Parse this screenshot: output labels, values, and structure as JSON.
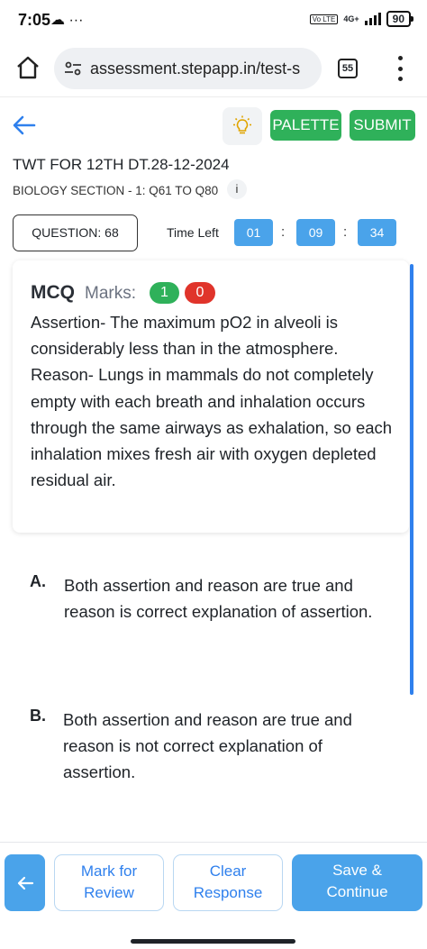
{
  "status_bar": {
    "time": "7:05",
    "left_icons": "☁ ···",
    "volte": "Vo LTE",
    "network": "4G+",
    "battery": "90"
  },
  "browser": {
    "url": "assessment.stepapp.in/test-s",
    "tab_count": "55"
  },
  "header": {
    "palette_label": "PALETTE",
    "submit_label": "SUBMIT"
  },
  "test": {
    "title": "TWT FOR 12TH DT.28-12-2024",
    "section": "BIOLOGY SECTION - 1: Q61 TO Q80",
    "info": "i",
    "question_number": "QUESTION: 68",
    "time_left_label": "Time Left",
    "time_hours": "01",
    "time_minutes": "09",
    "time_seconds": "34",
    "time_separator": ":"
  },
  "question": {
    "type": "MCQ",
    "marks_label": "Marks:",
    "marks_positive": "1",
    "marks_negative": "0",
    "text": "Assertion- The maximum pO2 in alveoli is considerably less than in the atmosphere. Reason- Lungs in mammals do not completely empty with each breath and inhalation occurs through the same  airways as exhalation, so each inhalation mixes fresh air with oxygen depleted residual air."
  },
  "options": [
    {
      "letter": "A.",
      "text": "Both assertion and reason are true and reason is correct explanation of assertion."
    },
    {
      "letter": "B.",
      "text": "Both assertion and reason are true and reason is not correct explanation of assertion."
    }
  ],
  "footer": {
    "mark_review_line1": "Mark for",
    "mark_review_line2": "Review",
    "clear_line1": "Clear",
    "clear_line2": "Response",
    "save_line1": "Save &",
    "save_line2": "Continue"
  },
  "colors": {
    "green": "#2fb15a",
    "red": "#e0342b",
    "blue": "#4aa3ea",
    "link_blue": "#2f80ed"
  },
  "icons": [
    "home-icon",
    "url-settings-icon",
    "tabs-icon",
    "menu-dots-icon",
    "back-arrow-icon",
    "lightbulb-icon",
    "info-icon",
    "left-arrow-icon"
  ]
}
